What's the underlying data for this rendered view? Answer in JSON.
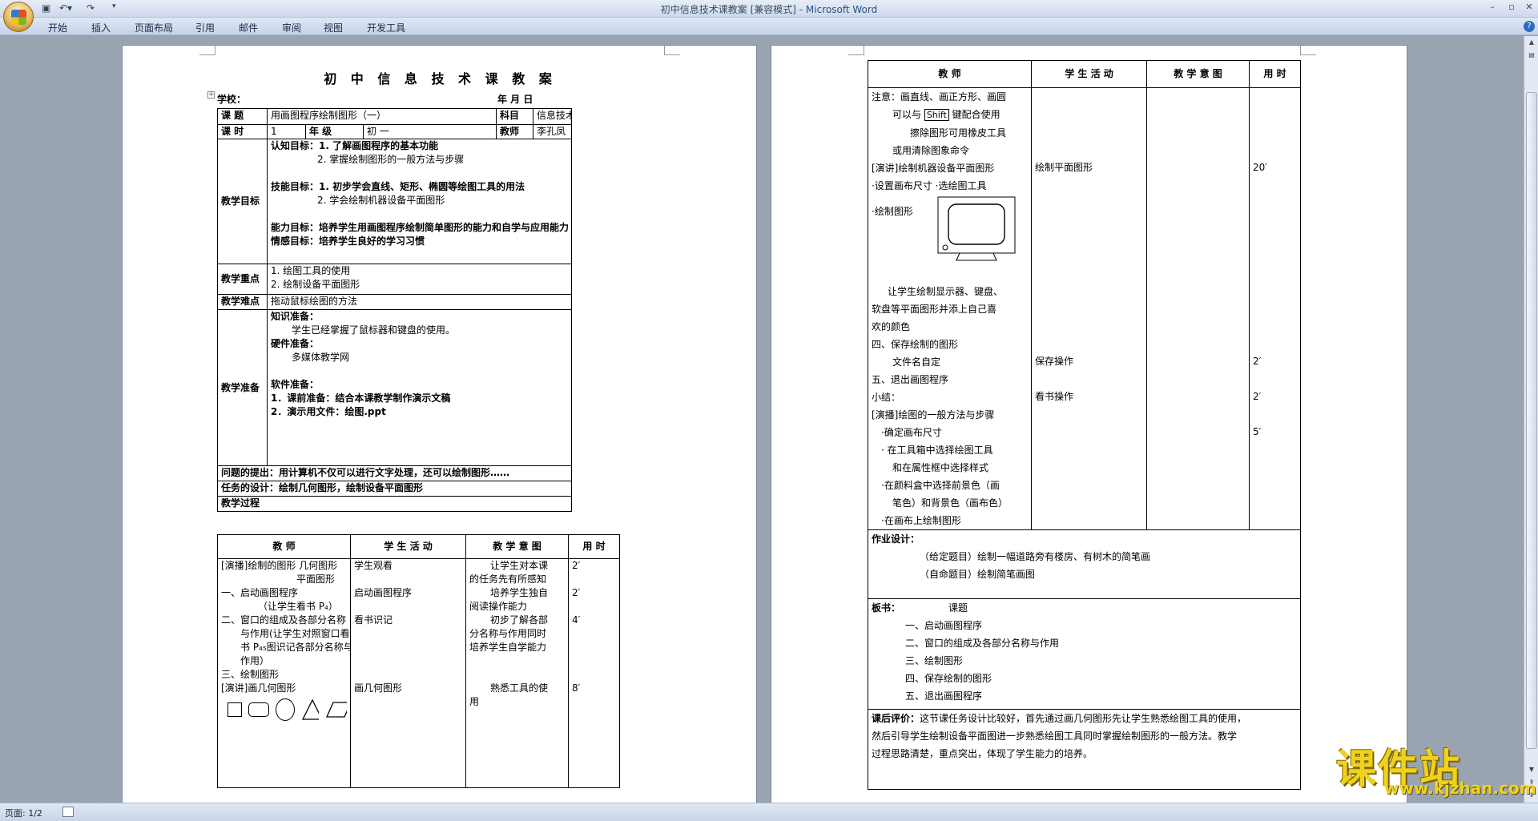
{
  "window": {
    "title": "初中信息技术课教案 [兼容模式] - Microsoft Word",
    "title_doc": "初中信息技术课教案 [兼容模式] - ",
    "title_app": "Microsoft Word"
  },
  "qat": {
    "save_icon": "save-icon",
    "undo_icon": "undo-icon",
    "redo_icon": "redo-icon"
  },
  "ribbon": {
    "tabs": [
      "开始",
      "插入",
      "页面布局",
      "引用",
      "邮件",
      "审阅",
      "视图",
      "开发工具"
    ]
  },
  "status": {
    "page": "页面: 1/2"
  },
  "watermark": {
    "cn": "课件站",
    "url": "www.kjzhan.com"
  },
  "doc": {
    "title": "初 中 信 息 技 术 课 教 案",
    "school_label": "学校：",
    "date_label": "年    月    日",
    "header": {
      "topic_label": "课    题",
      "topic_value": "用画图程序绘制图形（一）",
      "subject_label": "科目",
      "subject_value": "信息技术",
      "hours_label": "课    时",
      "hours_value": "1",
      "grade_label": "年    级",
      "grade_value": "初    一",
      "teacher_label": "教师",
      "teacher_value": "李孔凤"
    },
    "goals": {
      "label": "教学目标",
      "lines": [
        "认知目标：1. 了解画图程序的基本功能",
        "2. 掌握绘制图形的一般方法与步骤",
        "",
        "技能目标：1. 初步学会直线、矩形、椭圆等绘图工具的用法",
        "2. 学会绘制机器设备平面图形",
        "",
        "能力目标：培养学生用画图程序绘制简单图形的能力和自学与应用能力",
        "情感目标：培养学生良好的学习习惯"
      ]
    },
    "key_points": {
      "label": "教学重点",
      "lines": [
        "1.    绘图工具的使用",
        "2.    绘制设备平面图形"
      ]
    },
    "difficulty": {
      "label": "教学难点",
      "value": "拖动鼠标绘图的方法"
    },
    "prep": {
      "label": "教学准备",
      "lines": [
        "知识准备：",
        "学生已经掌握了鼠标器和键盘的使用。",
        "硬件准备：",
        "多媒体教学网",
        "",
        "软件准备：",
        "1．课前准备：结合本课教学制作演示文稿",
        "2．演示用文件：绘图.ppt",
        ""
      ]
    },
    "question": "问题的提出：用计算机不仅可以进行文字处理，还可以绘制图形……",
    "task": "任务的设计：绘制几何图形，绘制设备平面图形",
    "process_label": "教学过程",
    "process_headers": [
      "教    师",
      "学 生 活 动",
      "教 学 意 图",
      "用 时"
    ],
    "process_p1": {
      "teacher": [
        "[演播]绘制的图形    几何图形",
        "平面图形",
        "一、启动画图程序",
        "（让学生看书 P₄）",
        "二、窗口的组成及各部分名称",
        "与作用(让学生对照窗口看",
        "书 P₄₅图识记各部分名称与",
        "作用）",
        "三、绘制图形",
        "[演讲]画几何图形"
      ],
      "student": [
        "学生观看",
        "",
        "启动画图程序",
        "",
        "看书识记",
        "",
        "",
        "",
        "",
        "画几何图形"
      ],
      "intent": [
        "让学生对本课",
        "的任务先有所感知",
        "培养学生独自",
        "阅读操作能力",
        "初步了解各部",
        "分名称与作用同时",
        "培养学生自学能力",
        "",
        "",
        "熟悉工具的使",
        "用"
      ],
      "time": [
        "2′",
        "",
        "2′",
        "",
        "4′",
        "",
        "",
        "",
        "",
        "8′"
      ]
    },
    "process_p2": {
      "teacher": [
        "注意：画直线、画正方形、画圆",
        "可以与 Shift 键配合使用",
        "擦除图形可用橡皮工具",
        "或用清除图象命令",
        "[演讲]绘制机器设备平面图形",
        "·设置画布尺寸  ·选绘图工具",
        "·绘制图形",
        "",
        "",
        "让学生绘制显示器、键盘、",
        "软盘等平面图形并添上自己喜",
        "欢的颜色",
        "四、保存绘制的图形",
        "文件名自定",
        "五、退出画图程序",
        "小结：",
        "[演播]绘图的一般方法与步骤",
        "·确定画布尺寸",
        "·  在工具箱中选择绘图工具",
        "和在属性框中选择样式",
        "·在颜料盒中选择前景色（画",
        "笔色）和背景色（画布色）",
        "·在画布上绘制图形"
      ],
      "student": [
        "绘制平面图形",
        "保存操作",
        "看书操作"
      ],
      "time": [
        "20′",
        "2′",
        "2′",
        "5′"
      ],
      "shift_key": "Shift"
    },
    "homework": {
      "label": "作业设计：",
      "lines": [
        "（给定题目）绘制一幅道路旁有楼房、有树木的简笔画",
        "（自命题目）绘制简笔画图"
      ]
    },
    "board": {
      "label": "板书：",
      "topic": "课题",
      "lines": [
        "一、启动画图程序",
        "二、窗口的组成及各部分名称与作用",
        "三、绘制图形",
        "四、保存绘制的图形",
        "五、退出画图程序"
      ]
    },
    "review": {
      "label": "课后评价：",
      "text1": "这节课任务设计比较好，首先通过画几何图形先让学生熟悉绘图工具的使用，",
      "text2": "然后引导学生绘制设备平面图进一步熟悉绘图工具同时掌握绘制图形的一般方法。教学",
      "text3": "过程思路清楚，重点突出，体现了学生能力的培养。"
    }
  }
}
